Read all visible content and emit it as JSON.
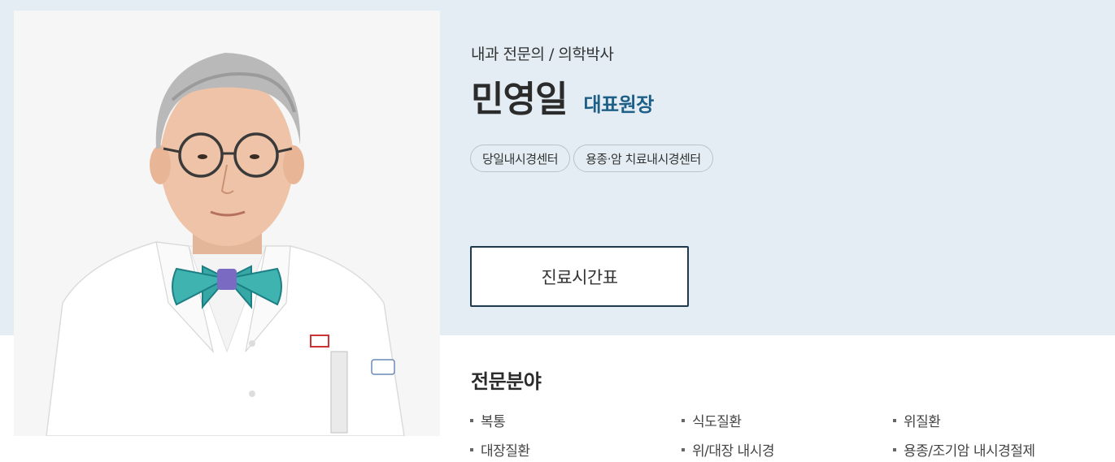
{
  "doctor": {
    "subtitle": "내과 전문의 / 의학박사",
    "name": "민영일",
    "title": "대표원장",
    "photo_description_icon": "doctor-portrait"
  },
  "tags": [
    "당일내시경센터",
    "용종·암 치료내시경센터"
  ],
  "schedule_button": {
    "label": "진료시간표"
  },
  "specialties": {
    "heading": "전문분야",
    "items": [
      "복통",
      "식도질환",
      "위질환",
      "대장질환",
      "위/대장 내시경",
      "용종/조기암 내시경절제"
    ]
  },
  "colors": {
    "band_background": "#e3edf3",
    "title_accent": "#1d5f86",
    "button_border": "#1f3a4d"
  }
}
